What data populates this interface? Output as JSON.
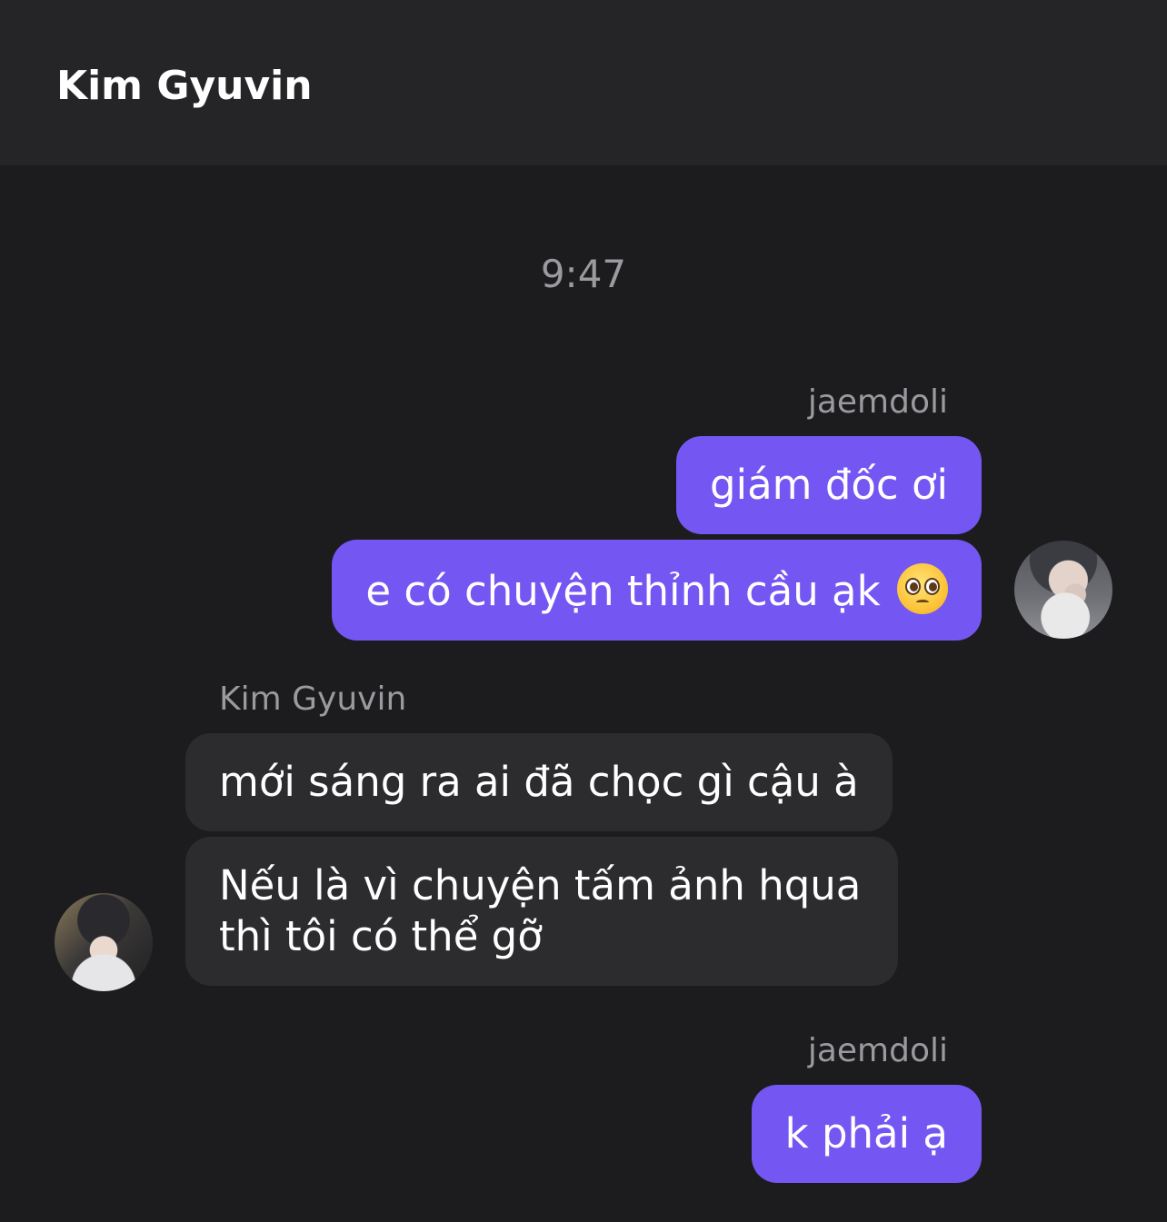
{
  "header": {
    "title": "Kim Gyuvin"
  },
  "timestamp": "9:47",
  "messages": [
    {
      "sender": "jaemdoli",
      "direction": "outgoing",
      "texts": [
        "giám đốc ơi",
        "e có chuyện thỉnh cầu ạk"
      ],
      "emoji": "pleading-face"
    },
    {
      "sender": "Kim Gyuvin",
      "direction": "incoming",
      "texts": [
        "mới sáng ra ai đã chọc gì cậu à",
        "Nếu là vì chuyện tấm ảnh hqua",
        "thì tôi có thể gỡ"
      ]
    },
    {
      "sender": "jaemdoli",
      "direction": "outgoing",
      "texts": [
        "k phải ạ"
      ]
    }
  ],
  "colors": {
    "background": "#1c1c1e",
    "header": "#252527",
    "outgoing_bubble": "#7457f2",
    "incoming_bubble": "#2c2c2e",
    "meta_text": "#9a9a9f"
  }
}
